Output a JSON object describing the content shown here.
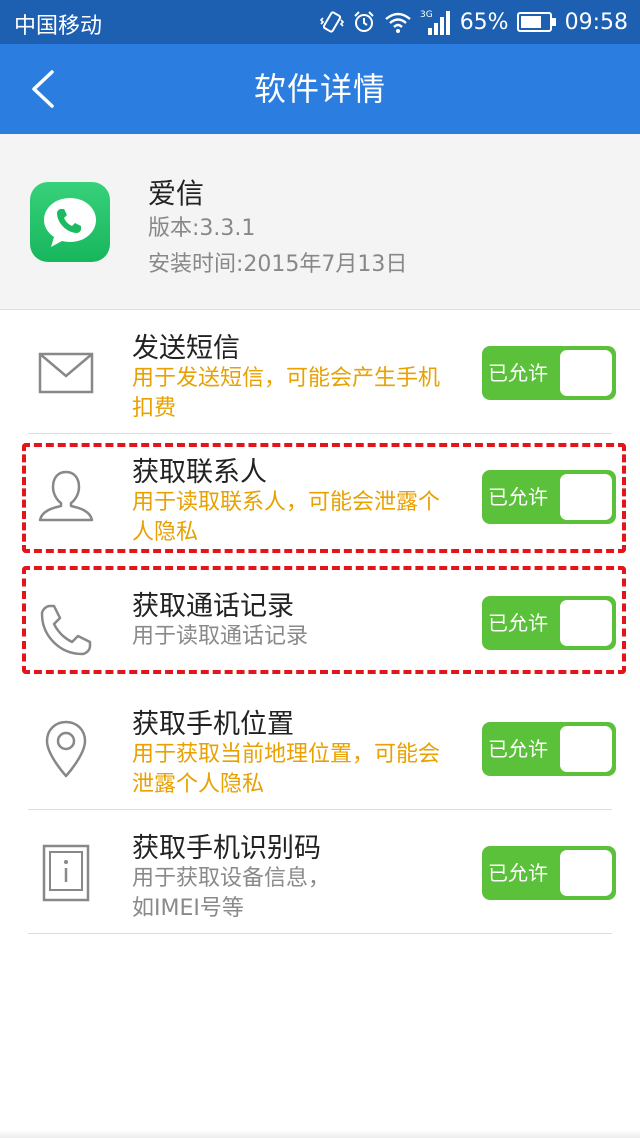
{
  "status_bar": {
    "carrier": "中国移动",
    "network": "3G",
    "battery": "65%",
    "time": "09:58"
  },
  "app_bar": {
    "title": "软件详情"
  },
  "app_info": {
    "name": "爱信",
    "version": "版本:3.3.1",
    "install_time": "安装时间:2015年7月13日"
  },
  "permissions": [
    {
      "icon": "envelope-icon",
      "title": "发送短信",
      "desc": "用于发送短信，可能会产生手机扣费",
      "desc_style": "warn",
      "toggle": "已允许",
      "highlighted": false
    },
    {
      "icon": "person-icon",
      "title": "获取联系人",
      "desc": "用于读取联系人，可能会泄露个人隐私",
      "desc_style": "warn",
      "toggle": "已允许",
      "highlighted": true
    },
    {
      "icon": "phone-icon",
      "title": "获取通话记录",
      "desc": "用于读取通话记录",
      "desc_style": "normal",
      "toggle": "已允许",
      "highlighted": true
    },
    {
      "icon": "location-pin-icon",
      "title": "获取手机位置",
      "desc": "用于获取当前地理位置，可能会泄露个人隐私",
      "desc_style": "warn",
      "toggle": "已允许",
      "highlighted": false
    },
    {
      "icon": "device-info-icon",
      "title": "获取手机识别码",
      "desc": "用于获取设备信息，如IMEI号等",
      "desc_style": "normal",
      "toggle": "已允许",
      "highlighted": false
    }
  ],
  "colors": {
    "status_bar": "#1d5fb0",
    "app_bar": "#2c7de0",
    "toggle_on": "#5cc13a",
    "warning_text": "#e8a100",
    "highlight_border": "#e3151a"
  }
}
